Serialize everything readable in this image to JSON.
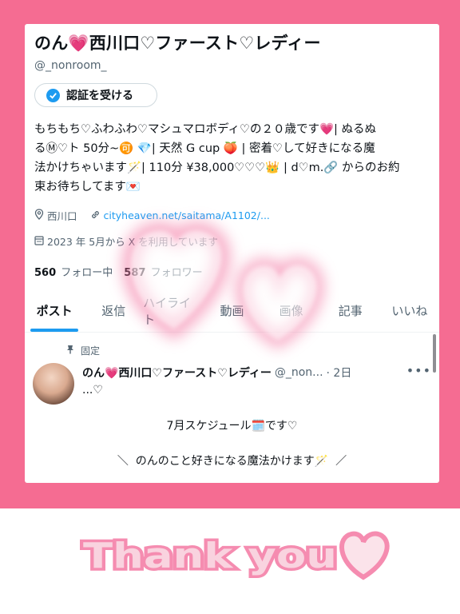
{
  "profile": {
    "display_name": "のん💗西川口♡ファースト♡レディー",
    "handle": "@_nonroom_",
    "verify_label": "認証を受ける",
    "bio_lines": [
      "もちもち♡ふわふわ♡マシュマロボディ♡の２０歳です💗| ぬるぬ",
      "るⓂ♡ト 50分~🉑 💎| 天然 G cup 🍑 | 密着♡して好きになる魔",
      "法かけちゃいます🪄| 110分 ¥38,000♡♡♡👑 | d♡m.🔗 からのお約",
      "束お待ちしてます💌"
    ],
    "location": "西川口",
    "link": "cityheaven.net/saitama/A1102/...",
    "joined": "2023 年 5月から X を利用しています",
    "following_count": "560",
    "following_label": "フォロー中",
    "followers_count": "587",
    "followers_label": "フォロワー"
  },
  "tabs": [
    {
      "label": "ポスト"
    },
    {
      "label": "返信"
    },
    {
      "label": "ハイライト"
    },
    {
      "label": "動画"
    },
    {
      "label": "画像"
    },
    {
      "label": "記事"
    },
    {
      "label": "いいね"
    }
  ],
  "pinned_post": {
    "pinned_label": "固定",
    "author_name": "のん💗西川口♡ファースト♡レディー",
    "author_handle": "@_non...",
    "time": "· 2日",
    "more": "•••",
    "subline": "...♡",
    "line1": "7月スケジュール🗓️です♡",
    "line2": "＼  のんのこと好きになる魔法かけます🪄  ／"
  },
  "overlay": {
    "thanks_text": "Thank you"
  },
  "icons": {
    "verify": "verified-badge-icon",
    "location": "location-pin-icon",
    "link": "link-icon",
    "calendar": "calendar-icon",
    "pin": "pin-icon",
    "heart": "heart-icon"
  },
  "colors": {
    "frame": "#f56c92",
    "accent": "#1d9bf0",
    "secondary_text": "#536471",
    "thanks_fill": "#f7c9d8"
  }
}
